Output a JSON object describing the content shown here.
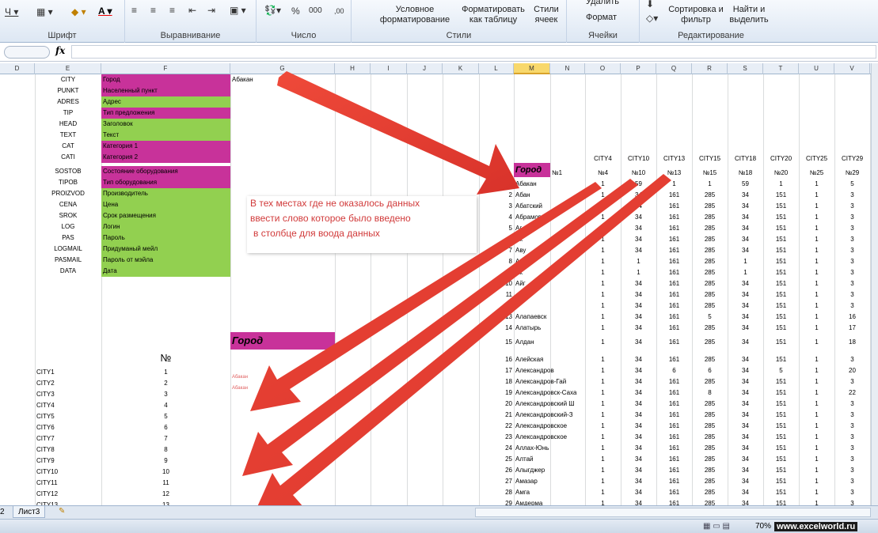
{
  "ribbon": {
    "font_label": "Шрифт",
    "align_label": "Выравнивание",
    "number_label": "Число",
    "styles_label": "Стили",
    "cells_label": "Ячейки",
    "edit_label": "Редактирование",
    "cond_fmt": "Условное форматирование",
    "fmt_table": "Форматировать как таблицу",
    "cell_styles": "Стили ячеек",
    "delete": "Удалить",
    "format": "Формат",
    "sort_filter": "Сортировка и фильтр",
    "find_select": "Найти и выделить"
  },
  "formula_bar": {
    "fx": "fx",
    "value": ""
  },
  "columns": [
    "D",
    "E",
    "F",
    "G",
    "H",
    "I",
    "J",
    "K",
    "L",
    "M",
    "N",
    "O",
    "P",
    "Q",
    "R",
    "S",
    "T",
    "U",
    "V"
  ],
  "selected_column": "M",
  "g_top": "Абакан",
  "fields": [
    {
      "code": "CITY",
      "label": "Город",
      "color": "#c8329a"
    },
    {
      "code": "PUNKT",
      "label": "Населенный пункт",
      "color": "#c8329a"
    },
    {
      "code": "ADRES",
      "label": "Адрес",
      "color": "#92d050"
    },
    {
      "code": "TIP",
      "label": "Тип предложения",
      "color": "#c8329a"
    },
    {
      "code": "HEAD",
      "label": "Заголовок",
      "color": "#92d050"
    },
    {
      "code": "TEXT",
      "label": "Текст",
      "color": "#92d050"
    },
    {
      "code": "CAT",
      "label": "Категория 1",
      "color": "#c8329a"
    },
    {
      "code": "CATI",
      "label": "Категория 2",
      "color": "#c8329a"
    },
    {
      "code": "SOSTOB",
      "label": "Состояние оборудования",
      "color": "#c8329a"
    },
    {
      "code": "TIPOB",
      "label": "Тип оборудования",
      "color": "#c8329a"
    },
    {
      "code": "PROIZVOD",
      "label": "Производитель",
      "color": "#92d050"
    },
    {
      "code": "CENA",
      "label": "Цена",
      "color": "#92d050"
    },
    {
      "code": "SROK",
      "label": "Срок размещения",
      "color": "#92d050"
    },
    {
      "code": "LOG",
      "label": "Логин",
      "color": "#92d050"
    },
    {
      "code": "PAS",
      "label": "Пароль",
      "color": "#92d050"
    },
    {
      "code": "LOGMAIL",
      "label": "Придуманый мейл",
      "color": "#92d050"
    },
    {
      "code": "PASMAIL",
      "label": "Пароль от мэйла",
      "color": "#92d050"
    },
    {
      "code": "DATA",
      "label": "Дата",
      "color": "#92d050"
    }
  ],
  "gorod_box": "Город",
  "num_header": "№",
  "left_list": [
    [
      "CITY1",
      "1"
    ],
    [
      "CITY2",
      "2"
    ],
    [
      "CITY3",
      "3"
    ],
    [
      "CITY4",
      "4"
    ],
    [
      "CITY5",
      "5"
    ],
    [
      "CITY6",
      "6"
    ],
    [
      "CITY7",
      "7"
    ],
    [
      "CITY8",
      "8"
    ],
    [
      "CITY9",
      "9"
    ],
    [
      "CITY10",
      "10"
    ],
    [
      "CITY11",
      "11"
    ],
    [
      "CITY12",
      "12"
    ],
    [
      "CITY13",
      "13"
    ]
  ],
  "small_red": [
    "Абакан",
    "Абакан"
  ],
  "city_headers": [
    "CITY4",
    "CITY10",
    "CITY13",
    "CITY15",
    "CITY18",
    "CITY20",
    "CITY25",
    "CITY29"
  ],
  "num_headers": [
    "№4",
    "№10",
    "№13",
    "№15",
    "№18",
    "№20",
    "№25",
    "№29"
  ],
  "table_gorod": "Город",
  "table_n1": "№1",
  "rows": [
    [
      "1",
      "Абакан",
      "1",
      "59",
      "1",
      "1",
      "59",
      "1",
      "1",
      "5"
    ],
    [
      "2",
      "Абан",
      "1",
      "34",
      "161",
      "285",
      "34",
      "151",
      "1",
      "3"
    ],
    [
      "3",
      "Абатский",
      "1",
      "34",
      "161",
      "285",
      "34",
      "151",
      "1",
      "3"
    ],
    [
      "4",
      "Абрамов",
      "1",
      "34",
      "161",
      "285",
      "34",
      "151",
      "1",
      "3"
    ],
    [
      "5",
      "Аг",
      "1",
      "34",
      "161",
      "285",
      "34",
      "151",
      "1",
      "3"
    ],
    [
      "6",
      "Ак",
      "1",
      "34",
      "161",
      "285",
      "34",
      "151",
      "1",
      "3"
    ],
    [
      "7",
      "Аву",
      "1",
      "34",
      "161",
      "285",
      "34",
      "151",
      "1",
      "3"
    ],
    [
      "8",
      "Ак",
      "1",
      "1",
      "161",
      "285",
      "1",
      "151",
      "1",
      "3"
    ],
    [
      "9",
      "Ак",
      "1",
      "1",
      "161",
      "285",
      "1",
      "151",
      "1",
      "3"
    ],
    [
      "10",
      "Айг",
      "1",
      "34",
      "161",
      "285",
      "34",
      "151",
      "1",
      "3"
    ],
    [
      "11",
      "",
      "1",
      "34",
      "161",
      "285",
      "34",
      "151",
      "1",
      "3"
    ],
    [
      "12",
      "",
      "1",
      "34",
      "161",
      "285",
      "34",
      "151",
      "1",
      "3"
    ],
    [
      "13",
      "Алапаевск",
      "1",
      "34",
      "161",
      "5",
      "34",
      "151",
      "1",
      "16"
    ],
    [
      "14",
      "Алатырь",
      "1",
      "34",
      "161",
      "285",
      "34",
      "151",
      "1",
      "17"
    ],
    [
      "15",
      "Алдан",
      "1",
      "34",
      "161",
      "285",
      "34",
      "151",
      "1",
      "18"
    ],
    [
      "16",
      "Алейская",
      "1",
      "34",
      "161",
      "285",
      "34",
      "151",
      "1",
      "3"
    ],
    [
      "17",
      "Александров",
      "1",
      "34",
      "6",
      "6",
      "34",
      "5",
      "1",
      "20"
    ],
    [
      "18",
      "Александров-Гай",
      "1",
      "34",
      "161",
      "285",
      "34",
      "151",
      "1",
      "3"
    ],
    [
      "19",
      "Александровск-Саха",
      "1",
      "34",
      "161",
      "8",
      "34",
      "151",
      "1",
      "22"
    ],
    [
      "20",
      "Александровский Ш",
      "1",
      "34",
      "161",
      "285",
      "34",
      "151",
      "1",
      "3"
    ],
    [
      "21",
      "Александровский-З",
      "1",
      "34",
      "161",
      "285",
      "34",
      "151",
      "1",
      "3"
    ],
    [
      "22",
      "Александровское",
      "1",
      "34",
      "161",
      "285",
      "34",
      "151",
      "1",
      "3"
    ],
    [
      "23",
      "Александровское",
      "1",
      "34",
      "161",
      "285",
      "34",
      "151",
      "1",
      "3"
    ],
    [
      "24",
      "Аллах-Юнь",
      "1",
      "34",
      "161",
      "285",
      "34",
      "151",
      "1",
      "3"
    ],
    [
      "25",
      "Алтай",
      "1",
      "34",
      "161",
      "285",
      "34",
      "151",
      "1",
      "3"
    ],
    [
      "26",
      "Алыгджер",
      "1",
      "34",
      "161",
      "285",
      "34",
      "151",
      "1",
      "3"
    ],
    [
      "27",
      "Амазар",
      "1",
      "34",
      "161",
      "285",
      "34",
      "151",
      "1",
      "3"
    ],
    [
      "28",
      "Амга",
      "1",
      "34",
      "161",
      "285",
      "34",
      "151",
      "1",
      "3"
    ],
    [
      "29",
      "Амдерма",
      "1",
      "34",
      "161",
      "285",
      "34",
      "151",
      "1",
      "3"
    ]
  ],
  "callout": [
    "В тех местах где не оказалось данных",
    "ввести слово которое было введено",
    "в столбце для воода данных"
  ],
  "tabs": [
    "2",
    "Лист3"
  ],
  "zoom": "70%",
  "watermark": "www.excelworld.ru"
}
